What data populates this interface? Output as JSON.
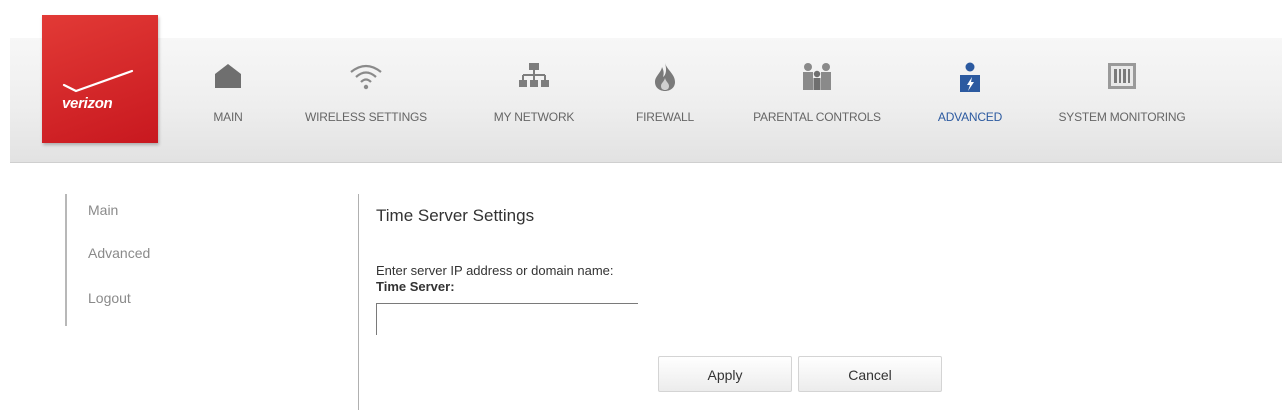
{
  "brand": {
    "logo_text": "verizon",
    "color": "#d52b1e"
  },
  "nav": {
    "items": [
      {
        "label": "MAIN",
        "icon": "house-icon"
      },
      {
        "label": "WIRELESS SETTINGS",
        "icon": "wifi-icon"
      },
      {
        "label": "MY NETWORK",
        "icon": "network-icon"
      },
      {
        "label": "FIREWALL",
        "icon": "fire-icon"
      },
      {
        "label": "PARENTAL CONTROLS",
        "icon": "family-icon"
      },
      {
        "label": "ADVANCED",
        "icon": "advanced-user-icon",
        "active": true
      },
      {
        "label": "SYSTEM MONITORING",
        "icon": "monitor-icon"
      }
    ],
    "active_color": "#2c5aa0"
  },
  "sidebar": {
    "items": [
      {
        "label": "Main"
      },
      {
        "label": "Advanced"
      },
      {
        "label": "Logout"
      }
    ]
  },
  "content": {
    "title": "Time Server Settings",
    "instruction": "Enter server IP address or domain name:",
    "field_label": "Time Server:",
    "time_server_value": "",
    "apply_label": "Apply",
    "cancel_label": "Cancel"
  }
}
